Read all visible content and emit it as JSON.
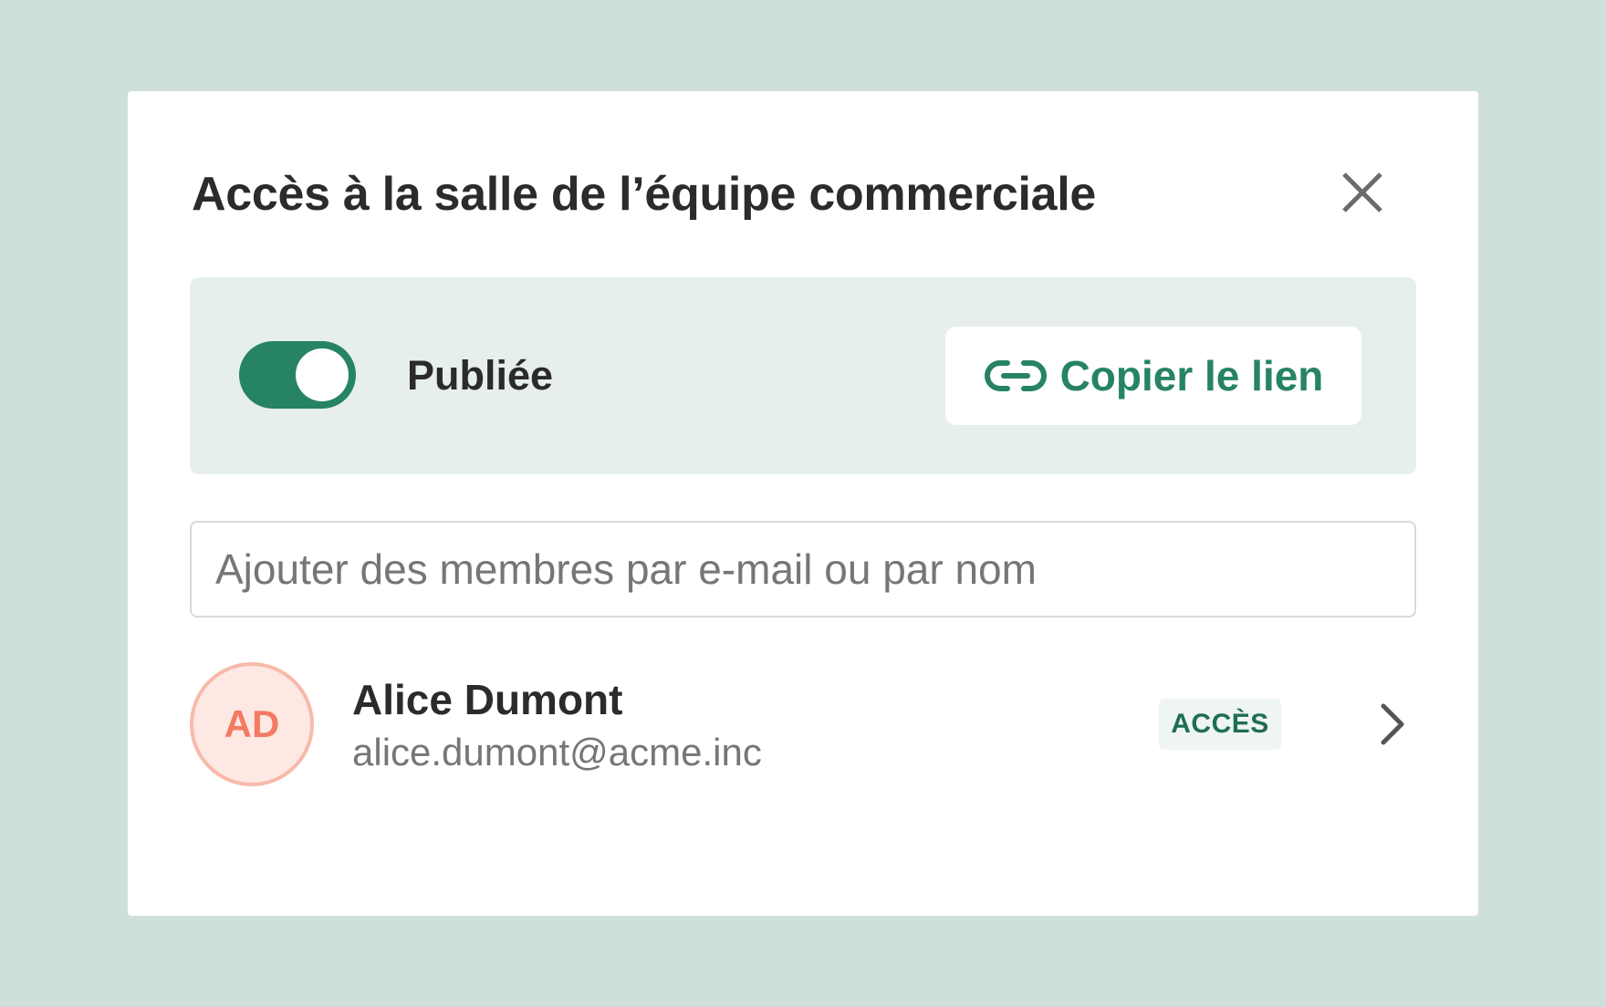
{
  "modal": {
    "title": "Accès à la salle de l’équipe commerciale",
    "close_icon": "close-icon"
  },
  "publish": {
    "enabled": true,
    "label": "Publiée",
    "copy_link_label": "Copier le lien",
    "link_icon": "link-icon"
  },
  "search": {
    "value": "",
    "placeholder": "Ajouter des membres par e-mail ou par nom"
  },
  "members": [
    {
      "initials": "AD",
      "name": "Alice Dumont",
      "email": "alice.dumont@acme.inc",
      "badge": "ACCÈS",
      "chevron_icon": "chevron-right-icon"
    }
  ],
  "colors": {
    "background": "#cfe0da",
    "accent": "#268363",
    "panel": "#e7efec",
    "avatar_text": "#f47a62",
    "avatar_fill": "#fde8e4",
    "avatar_border": "#f8b9ab",
    "badge_text": "#1f6e52",
    "badge_fill": "#eef5f2"
  }
}
